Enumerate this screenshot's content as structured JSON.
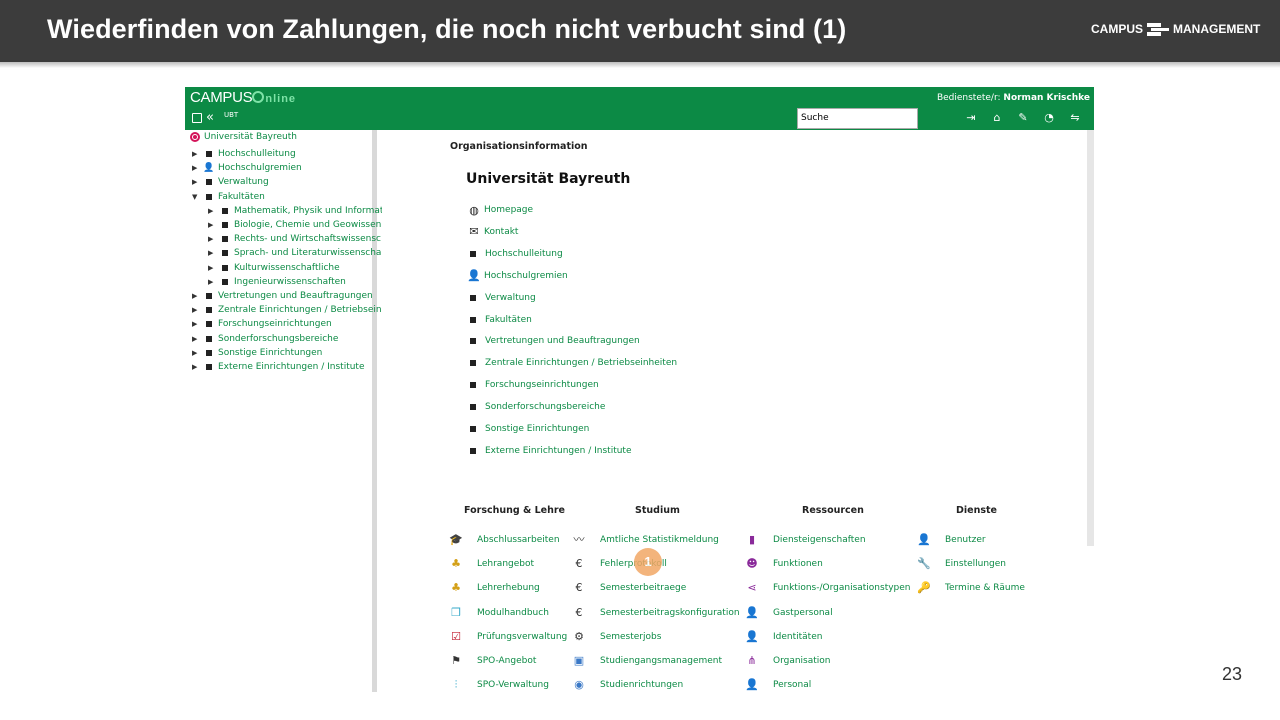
{
  "slide": {
    "title": "Wiederfinden von Zahlungen, die noch nicht verbucht sind (1)",
    "brand_left": "CAMPUS",
    "brand_right": "MANAGEMENT",
    "page_number": "23"
  },
  "app": {
    "logo_campus": "CAMPUS",
    "logo_online": "nline",
    "org_code": "UBT",
    "user_label": "Bedienstete/r:",
    "user_name": "Norman Krischke",
    "search_value": "Suche",
    "top_actions": [
      "logout-icon",
      "home-icon",
      "edit-icon",
      "dashboard-icon",
      "translate-icon"
    ]
  },
  "sidebar": {
    "root": "Universität Bayreuth",
    "items": [
      {
        "label": "Hochschulleitung",
        "level": 0,
        "icon": "bullet",
        "expanded": false
      },
      {
        "label": "Hochschulgremien",
        "level": 0,
        "icon": "person",
        "expanded": false
      },
      {
        "label": "Verwaltung",
        "level": 0,
        "icon": "bullet",
        "expanded": false
      },
      {
        "label": "Fakultäten",
        "level": 0,
        "icon": "bullet",
        "expanded": true
      },
      {
        "label": "Mathematik, Physik und Informat",
        "level": 1,
        "icon": "bullet",
        "expanded": false
      },
      {
        "label": "Biologie, Chemie und Geowissen",
        "level": 1,
        "icon": "bullet",
        "expanded": false
      },
      {
        "label": "Rechts- und Wirtschaftswissensc",
        "level": 1,
        "icon": "bullet",
        "expanded": false
      },
      {
        "label": "Sprach- und Literaturwissenscha",
        "level": 1,
        "icon": "bullet",
        "expanded": false
      },
      {
        "label": "Kulturwissenschaftliche",
        "level": 1,
        "icon": "bullet",
        "expanded": false
      },
      {
        "label": "Ingenieurwissenschaften",
        "level": 1,
        "icon": "bullet",
        "expanded": false
      },
      {
        "label": "Vertretungen und Beauftragungen",
        "level": 0,
        "icon": "bullet",
        "expanded": false
      },
      {
        "label": "Zentrale Einrichtungen / Betriebseinh",
        "level": 0,
        "icon": "bullet",
        "expanded": false
      },
      {
        "label": "Forschungseinrichtungen",
        "level": 0,
        "icon": "bullet",
        "expanded": false
      },
      {
        "label": "Sonderforschungsbereiche",
        "level": 0,
        "icon": "bullet",
        "expanded": false
      },
      {
        "label": "Sonstige Einrichtungen",
        "level": 0,
        "icon": "bullet",
        "expanded": false
      },
      {
        "label": "Externe Einrichtungen / Institute",
        "level": 0,
        "icon": "bullet",
        "expanded": false
      }
    ]
  },
  "main": {
    "section_heading": "Organisationsinformation",
    "org_name": "Universität Bayreuth",
    "links": [
      {
        "label": "Homepage",
        "icon": "globe-icon"
      },
      {
        "label": "Kontakt",
        "icon": "envelope-icon"
      },
      {
        "label": "Hochschulleitung",
        "icon": "bullet"
      },
      {
        "label": "Hochschulgremien",
        "icon": "person-icon"
      },
      {
        "label": "Verwaltung",
        "icon": "bullet"
      },
      {
        "label": "Fakultäten",
        "icon": "bullet"
      },
      {
        "label": "Vertretungen und Beauftragungen",
        "icon": "bullet"
      },
      {
        "label": "Zentrale Einrichtungen / Betriebseinheiten",
        "icon": "bullet"
      },
      {
        "label": "Forschungseinrichtungen",
        "icon": "bullet"
      },
      {
        "label": "Sonderforschungsbereiche",
        "icon": "bullet"
      },
      {
        "label": "Sonstige Einrichtungen",
        "icon": "bullet"
      },
      {
        "label": "Externe Einrichtungen / Institute",
        "icon": "bullet"
      }
    ],
    "columns": [
      {
        "heading": "Forschung & Lehre",
        "items": [
          {
            "label": "Abschlussarbeiten",
            "icon": "graduation-cap-icon"
          },
          {
            "label": "Lehrangebot",
            "icon": "teacher-icon"
          },
          {
            "label": "Lehrerhebung",
            "icon": "teacher-icon"
          },
          {
            "label": "Modulhandbuch",
            "icon": "cube-icon"
          },
          {
            "label": "Prüfungsverwaltung",
            "icon": "checkbox-icon"
          },
          {
            "label": "SPO-Angebot",
            "icon": "signpost-icon"
          },
          {
            "label": "SPO-Verwaltung",
            "icon": "sitemap-icon"
          }
        ]
      },
      {
        "heading": "Studium",
        "items": [
          {
            "label": "Amtliche Statistikmeldung",
            "icon": "chart-icon"
          },
          {
            "label": "Fehlerprotokoll",
            "icon": "euro-icon"
          },
          {
            "label": "Semesterbeitraege",
            "icon": "euro-icon"
          },
          {
            "label": "Semesterbeitragskonfiguration",
            "icon": "euro-icon"
          },
          {
            "label": "Semesterjobs",
            "icon": "gears-icon"
          },
          {
            "label": "Studiengangsmanagement",
            "icon": "sgm-icon"
          },
          {
            "label": "Studienrichtungen",
            "icon": "compass-icon"
          }
        ]
      },
      {
        "heading": "Ressourcen",
        "items": [
          {
            "label": "Diensteigenschaften",
            "icon": "briefcase-icon"
          },
          {
            "label": "Funktionen",
            "icon": "masks-icon"
          },
          {
            "label": "Funktions-/Organisationstypen",
            "icon": "share-icon"
          },
          {
            "label": "Gastpersonal",
            "icon": "person-icon"
          },
          {
            "label": "Identitäten",
            "icon": "person-icon"
          },
          {
            "label": "Organisation",
            "icon": "org-chart-icon"
          },
          {
            "label": "Personal",
            "icon": "person-icon"
          }
        ]
      },
      {
        "heading": "Dienste",
        "items": [
          {
            "label": "Benutzer",
            "icon": "person-icon"
          },
          {
            "label": "Einstellungen",
            "icon": "wrench-icon"
          },
          {
            "label": "Termine & Räume",
            "icon": "key-icon"
          }
        ]
      }
    ]
  },
  "callout": {
    "number": "1"
  }
}
